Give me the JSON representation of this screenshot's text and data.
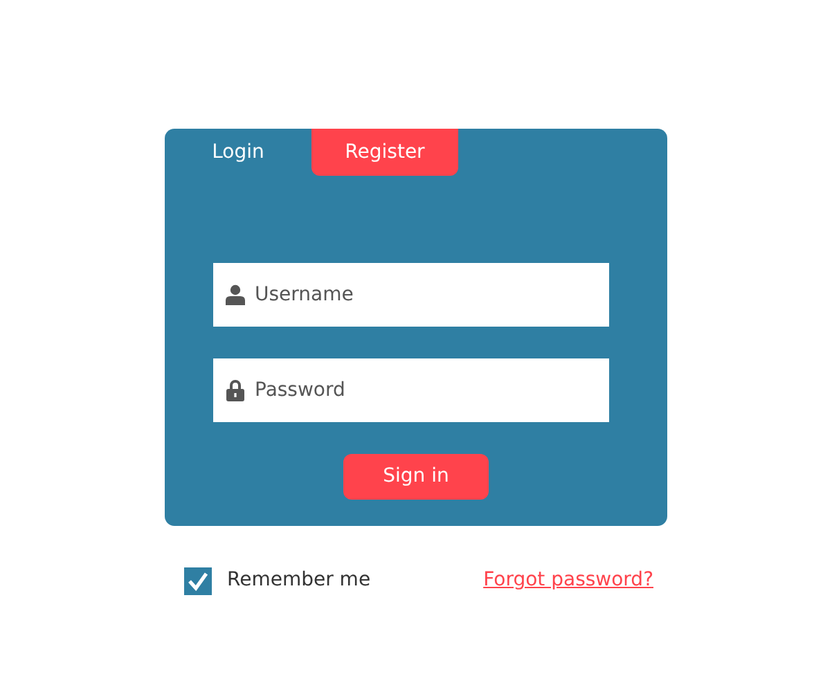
{
  "tabs": [
    {
      "label": "Login",
      "selected": false
    },
    {
      "label": "Register",
      "selected": true
    }
  ],
  "fields": [
    {
      "kind": "user",
      "placeholder": "Username"
    },
    {
      "kind": "lock",
      "placeholder": "Password"
    }
  ],
  "submit": {
    "label": "Sign in"
  },
  "remember": {
    "label": "Remember me",
    "checked": true
  },
  "forgot_link": {
    "label": "Forgot password?"
  }
}
